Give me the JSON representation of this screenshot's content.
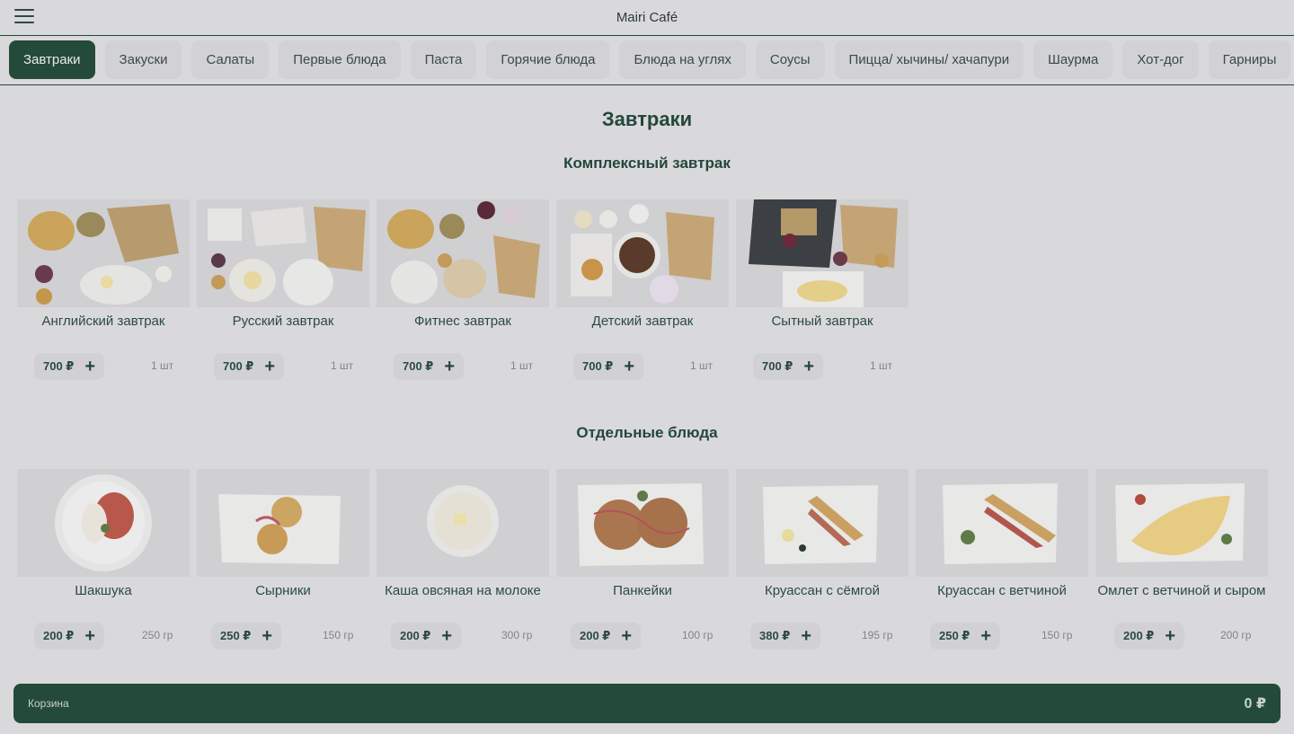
{
  "header": {
    "title": "Mairi Café"
  },
  "tabs": [
    {
      "label": "Завтраки",
      "active": true
    },
    {
      "label": "Закуски"
    },
    {
      "label": "Салаты"
    },
    {
      "label": "Первые блюда"
    },
    {
      "label": "Паста"
    },
    {
      "label": "Горячие блюда"
    },
    {
      "label": "Блюда на углях"
    },
    {
      "label": "Соусы"
    },
    {
      "label": "Пицца/ хычины/ хачапури"
    },
    {
      "label": "Шаурма"
    },
    {
      "label": "Хот-дог"
    },
    {
      "label": "Гарниры"
    }
  ],
  "page": {
    "title": "Завтраки"
  },
  "sections": [
    {
      "title": "Комплексный завтрак",
      "items": [
        {
          "name": "Английский завтрак",
          "price": "700 ₽",
          "qty": "1 шт"
        },
        {
          "name": "Русский завтрак",
          "price": "700 ₽",
          "qty": "1 шт"
        },
        {
          "name": "Фитнес завтрак",
          "price": "700 ₽",
          "qty": "1 шт"
        },
        {
          "name": "Детский завтрак",
          "price": "700 ₽",
          "qty": "1 шт"
        },
        {
          "name": "Сытный завтрак",
          "price": "700 ₽",
          "qty": "1 шт"
        }
      ]
    },
    {
      "title": "Отдельные блюда",
      "items": [
        {
          "name": "Шакшука",
          "price": "200 ₽",
          "qty": "250 гр"
        },
        {
          "name": "Сырники",
          "price": "250 ₽",
          "qty": "150 гр"
        },
        {
          "name": "Каша овсяная на молоке",
          "price": "200 ₽",
          "qty": "300 гр"
        },
        {
          "name": "Панкейки",
          "price": "200 ₽",
          "qty": "100 гр"
        },
        {
          "name": "Круассан с сёмгой",
          "price": "380 ₽",
          "qty": "195 гр"
        },
        {
          "name": "Круассан с ветчиной",
          "price": "250 ₽",
          "qty": "150 гр"
        },
        {
          "name": "Омлет с ветчиной и сыром",
          "price": "200 ₽",
          "qty": "200 гр"
        }
      ]
    }
  ],
  "cart": {
    "label": "Корзина",
    "total": "0 ₽"
  },
  "colors": {
    "accent": "#244a3a",
    "background": "#d9d9dc",
    "pill": "#d1d1d5"
  },
  "icons": {
    "menu": "hamburger-icon",
    "add": "plus-icon"
  }
}
